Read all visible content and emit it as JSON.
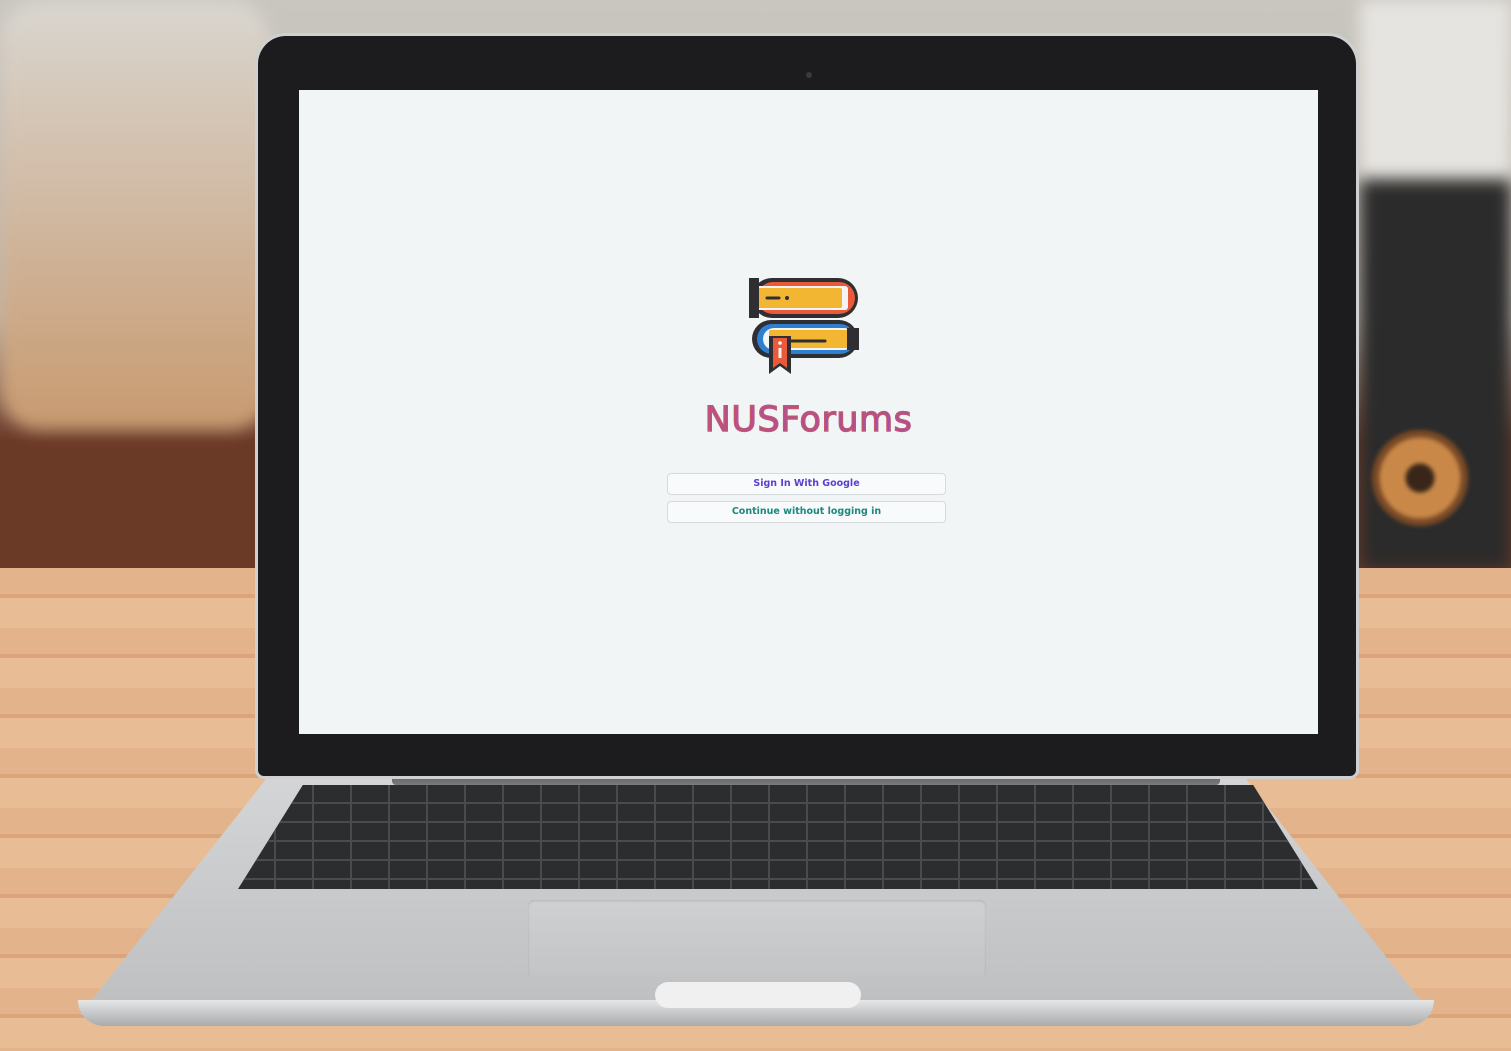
{
  "app": {
    "brand_name": "NUSForums",
    "logo_icon": "stacked-books-icon"
  },
  "actions": {
    "google_sign_in": "Sign In With Google",
    "guest": "Continue without logging in"
  },
  "colors": {
    "brand_gradient_start": "#d65b5b",
    "brand_gradient_end": "#7b4fd8",
    "google_button_text": "#5b3fd0",
    "guest_button_text": "#1a8a7e",
    "screen_background": "#f2f5f6"
  }
}
